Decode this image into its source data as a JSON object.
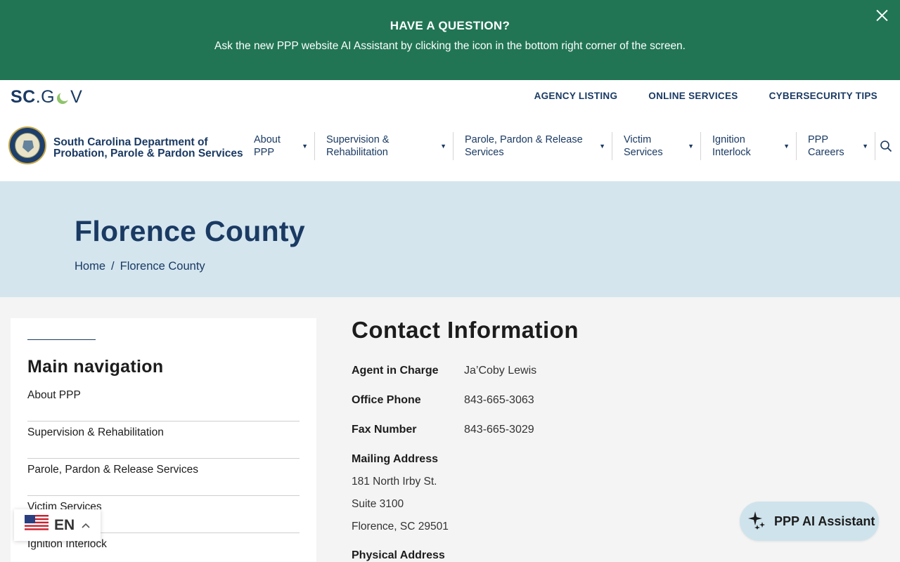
{
  "banner": {
    "title": "HAVE A QUESTION?",
    "text": "Ask the new PPP website AI Assistant by clicking the icon in the bottom right corner of the screen."
  },
  "header": {
    "scgov_sc": "SC",
    "scgov_g": ".G",
    "scgov_v": "V",
    "utility_links": [
      "AGENCY LISTING",
      "ONLINE SERVICES",
      "CYBERSECURITY TIPS"
    ],
    "agency_name_line1": "South Carolina Department of",
    "agency_name_line2": "Probation, Parole & Pardon Services",
    "nav": [
      {
        "line1": "About",
        "line2": "PPP"
      },
      {
        "line1": "Supervision &",
        "line2": "Rehabilitation"
      },
      {
        "line1": "Parole, Pardon & Release",
        "line2": "Services"
      },
      {
        "line1": "Victim",
        "line2": "Services"
      },
      {
        "line1": "Ignition",
        "line2": "Interlock"
      },
      {
        "line1": "PPP",
        "line2": "Careers"
      }
    ]
  },
  "hero": {
    "title": "Florence County",
    "breadcrumb": {
      "home": "Home",
      "separator": "/",
      "current": "Florence County"
    }
  },
  "sidebar": {
    "title": "Main navigation",
    "items": [
      "About PPP",
      "Supervision & Rehabilitation",
      "Parole, Pardon & Release Services",
      "Victim Services",
      "Ignition Interlock"
    ]
  },
  "contact": {
    "title": "Contact Information",
    "agent_label": "Agent in Charge",
    "agent_value": "Ja’Coby Lewis",
    "phone_label": "Office Phone",
    "phone_value": "843-665-3063",
    "fax_label": "Fax Number",
    "fax_value": "843-665-3029",
    "mailing_label": "Mailing Address",
    "mailing_lines": [
      "181 North Irby St.",
      "Suite 3100",
      "Florence, SC 29501"
    ],
    "physical_label": "Physical Address"
  },
  "language": {
    "code": "EN",
    "flag_icon": "us-flag-icon"
  },
  "assistant": {
    "label": "PPP AI Assistant",
    "icon": "sparkles-icon"
  },
  "colors": {
    "banner": "#217555",
    "primary": "#1a3a63",
    "hero_bg": "#d4e5ee",
    "assistant_bg": "#cfe3ec"
  }
}
